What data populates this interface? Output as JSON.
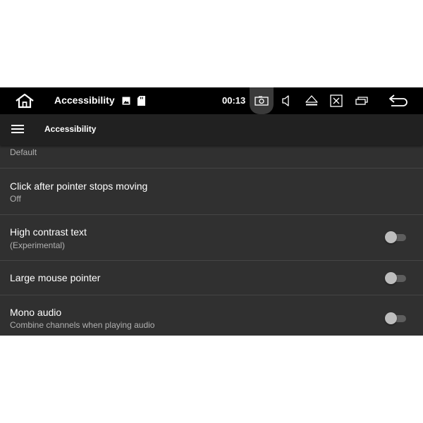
{
  "status_bar": {
    "title": "Accessibility",
    "time": "00:13"
  },
  "app_bar": {
    "title": "Accessibility"
  },
  "settings": [
    {
      "title": "",
      "summary": "Default"
    },
    {
      "title": "Click after pointer stops moving",
      "summary": "Off"
    },
    {
      "title": "High contrast text",
      "summary": "(Experimental)",
      "toggle_on": false
    },
    {
      "title": "Large mouse pointer",
      "summary": "",
      "toggle_on": false
    },
    {
      "title": "Mono audio",
      "summary": "Combine channels when playing audio",
      "toggle_on": false
    }
  ],
  "icons": [
    "home-icon",
    "image-icon",
    "sd-card-icon",
    "screenshot-icon",
    "volume-icon",
    "eject-icon",
    "close-window-icon",
    "window-icon",
    "back-icon",
    "menu-icon"
  ],
  "colors": {
    "status_bar": "#000000",
    "app_bar": "#212121",
    "background": "#303030",
    "text": "#ffffff",
    "secondary_text": "#b0b0b0"
  }
}
